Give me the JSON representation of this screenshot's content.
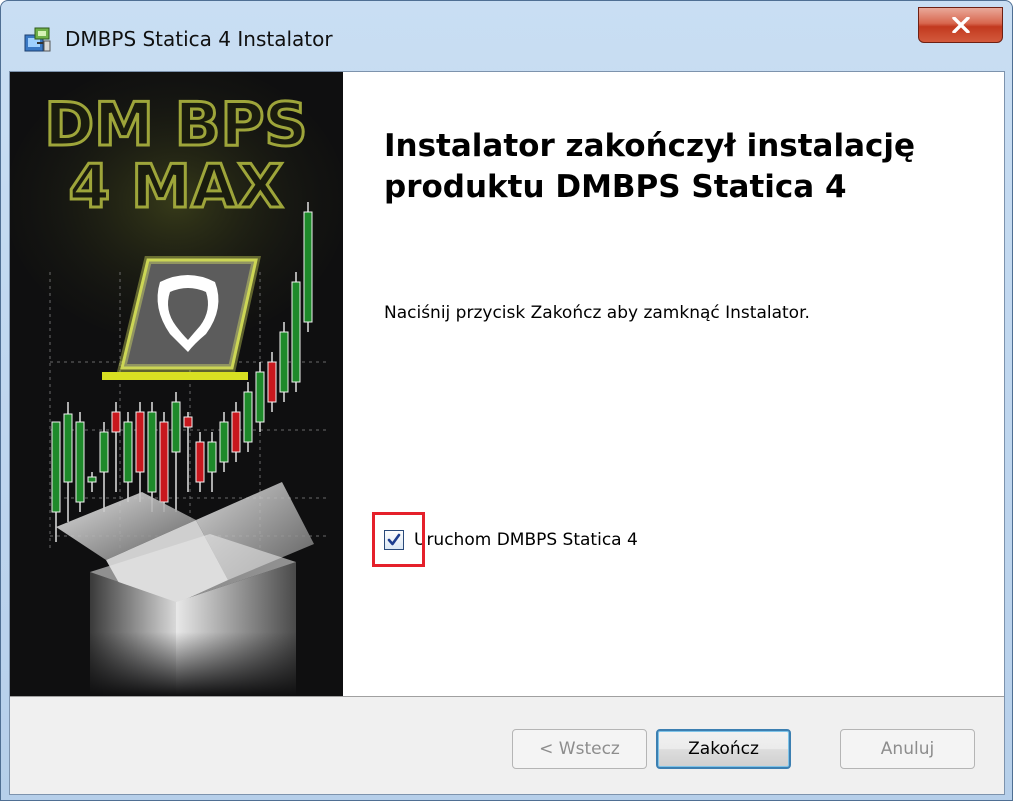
{
  "window": {
    "title": "DMBPS Statica 4 Instalator"
  },
  "banner": {
    "logo_line1": "DM BPS",
    "logo_line2": "4 MAX"
  },
  "content": {
    "heading": "Instalator zakończył instalację produktu DMBPS Statica 4",
    "description": "Naciśnij przycisk Zakończ aby zamknąć Instalator.",
    "launch_checkbox": {
      "label": "Uruchom DMBPS Statica 4",
      "checked": true
    }
  },
  "footer": {
    "back_label": "< Wstecz",
    "finish_label": "Zakończ",
    "cancel_label": "Anuluj"
  },
  "colors": {
    "highlight": "#e5202a",
    "candle_green": "#1e8a2a",
    "candle_red": "#c8181e",
    "logo_olive": "#9ea53a"
  }
}
